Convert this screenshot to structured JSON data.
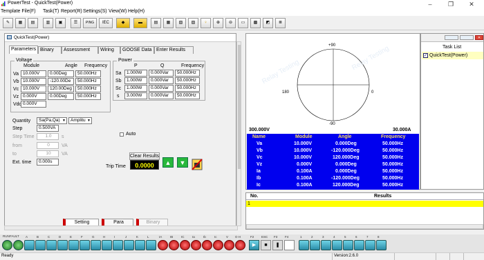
{
  "window": {
    "title": "PowerTest - QuickTest(Power)",
    "min": "–",
    "max": "❐",
    "close": "✕"
  },
  "menu": [
    "Template File(F)",
    "Task(T)",
    "Report(R)",
    "Settings(S)",
    "View(W)",
    "Help(H)"
  ],
  "toolbar": {
    "ping": "PING",
    "iec": "IEC"
  },
  "subwindow": {
    "title": "QuickTest(Power)"
  },
  "tabs": [
    "Parameters",
    "Binary",
    "Assessment",
    "Wiring",
    "GOOSE Data",
    "Enter Results"
  ],
  "voltage": {
    "title": "Voltage",
    "headers": [
      "Module",
      "Angle",
      "Frequency"
    ],
    "rows": [
      {
        "label": "Va",
        "module": "10.000V",
        "angle": "0.00Deg",
        "freq": "50.000Hz"
      },
      {
        "label": "Vb",
        "module": "10.000V",
        "angle": "-120.00De",
        "freq": "50.000Hz"
      },
      {
        "label": "Vc",
        "module": "10.000V",
        "angle": "120.00Deg",
        "freq": "50.000Hz"
      },
      {
        "label": "Vz",
        "module": "0.000V",
        "angle": "0.00Deg",
        "freq": "50.000Hz"
      }
    ],
    "vdc_label": "Vdc",
    "vdc": "0.000V"
  },
  "power": {
    "title": "Power",
    "headers": [
      "P",
      "Q",
      "Frequency"
    ],
    "rows": [
      {
        "label": "Sa",
        "p": "1.000W",
        "q": "0.000Var",
        "freq": "50.000Hz"
      },
      {
        "label": "Sb",
        "p": "1.000W",
        "q": "0.000Var",
        "freq": "50.000Hz"
      },
      {
        "label": "Sc",
        "p": "1.000W",
        "q": "0.000Var",
        "freq": "50.000Hz"
      },
      {
        "label": "s",
        "p": "3.000W",
        "q": "0.000Var",
        "freq": "50.000Hz"
      }
    ]
  },
  "controls": {
    "quantity_label": "Quantity",
    "quantity": "Sa(Pa,Qa)",
    "mode": "Amplitu",
    "step_label": "Step",
    "step": "0.500VA",
    "steptime_label": "Step Time",
    "steptime": "1.0",
    "steptime_unit": "s",
    "from_label": "from",
    "from": "0",
    "from_unit": "VA",
    "to_label": "to",
    "to": "10",
    "to_unit": "VA",
    "ext_label": "Ext. time",
    "ext": "0.000s",
    "auto_label": "Auto",
    "clear": "Clear Results",
    "trip_label": "Trip Time",
    "trip": "0.0000"
  },
  "bottom_tabs": [
    "Setting",
    "Para",
    "Binary"
  ],
  "phasor": {
    "top": "+90",
    "bottom": "-90",
    "left": "180",
    "right": "0",
    "vscale": "300.000V",
    "iscale": "30.000A",
    "watermark": "Relay Testing"
  },
  "table": {
    "headers": [
      "Name",
      "Module",
      "Angle",
      "Frequency"
    ],
    "rows": [
      [
        "Va",
        "10.000V",
        "0.000Deg",
        "50.000Hz"
      ],
      [
        "Vb",
        "10.000V",
        "-120.000Deg",
        "50.000Hz"
      ],
      [
        "Vc",
        "10.000V",
        "120.000Deg",
        "50.000Hz"
      ],
      [
        "Vz",
        "0.000V",
        "0.000Deg",
        "50.000Hz"
      ],
      [
        "Ia",
        "0.100A",
        "0.000Deg",
        "50.000Hz"
      ],
      [
        "Ib",
        "0.100A",
        "-120.000Deg",
        "50.000Hz"
      ],
      [
        "Ic",
        "0.100A",
        "120.000Deg",
        "50.000Hz"
      ]
    ]
  },
  "results": {
    "headers": [
      "No.",
      "Results"
    ],
    "first_row": "1"
  },
  "tasklist": {
    "title": "Task List",
    "item": "QuickTest(Power)"
  },
  "bottombar": {
    "run": "RUN",
    "fault": "FAULT",
    "inputs": [
      "A",
      "B",
      "C",
      "D",
      "E",
      "F",
      "G",
      "H",
      "I",
      "J",
      "K",
      "L"
    ],
    "currents": [
      "IA",
      "IB",
      "IC",
      "Ia",
      "Ib",
      "Ic",
      "V",
      "O H"
    ],
    "f": [
      "F2",
      "ESC",
      "F3",
      "F4"
    ],
    "outputs": [
      "1",
      "2",
      "3",
      "4",
      "5",
      "6",
      "7",
      "8"
    ]
  },
  "status": {
    "left": "Ready",
    "version": "Version:2.6.0"
  }
}
